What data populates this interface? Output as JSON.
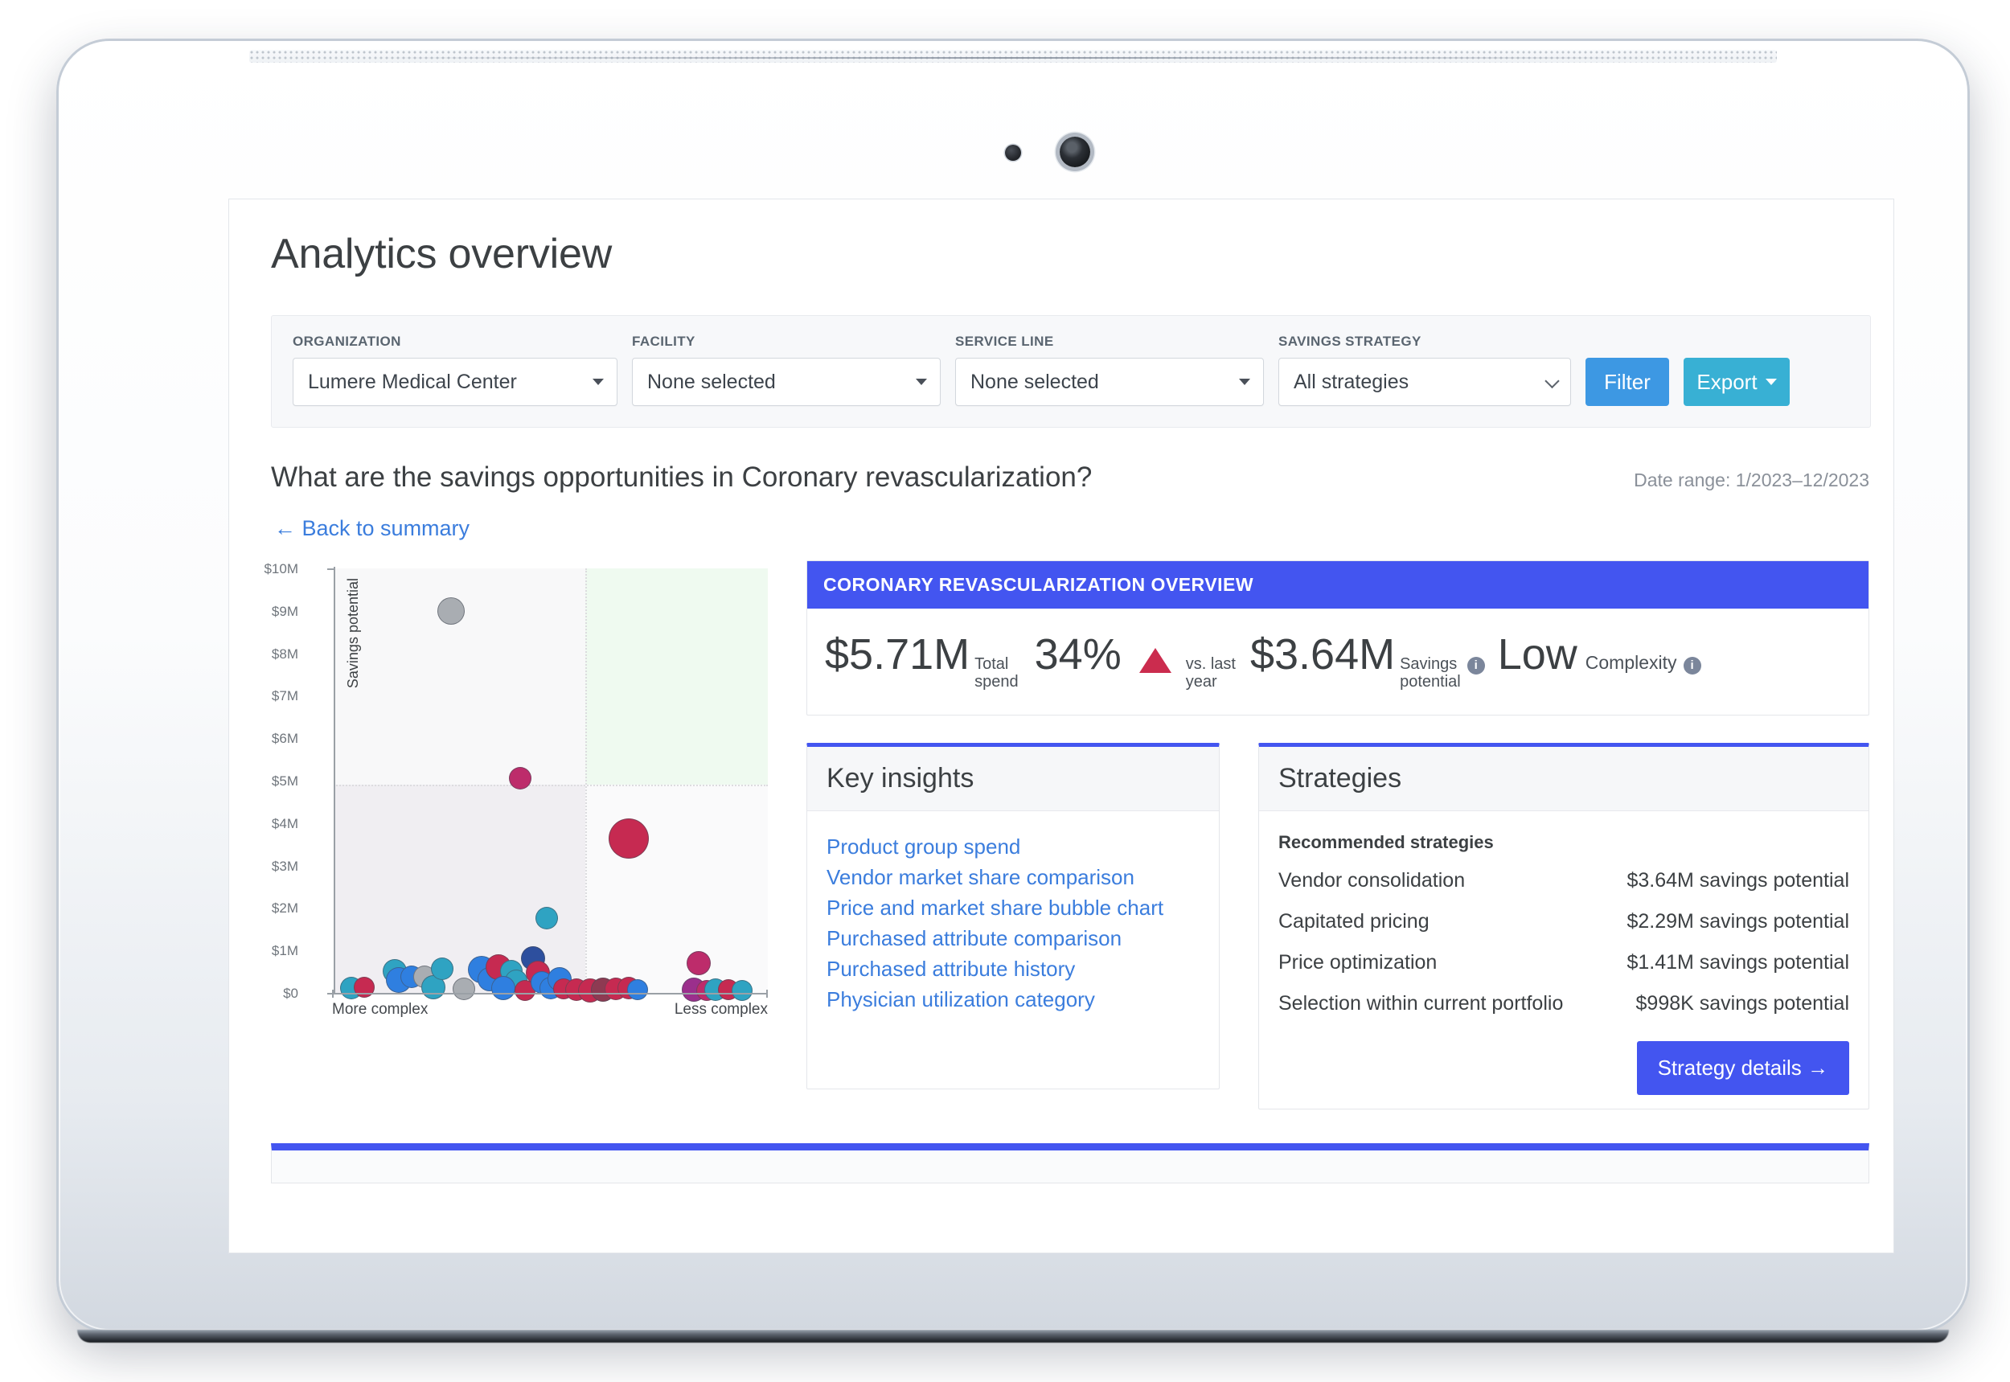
{
  "app": {
    "page_title": "Analytics overview"
  },
  "filters": {
    "organization": {
      "label": "ORGANIZATION",
      "value": "Lumere Medical Center"
    },
    "facility": {
      "label": "FACILITY",
      "value": "None selected"
    },
    "service_line": {
      "label": "SERVICE LINE",
      "value": "None selected"
    },
    "savings_strategy": {
      "label": "SAVINGS STRATEGY",
      "value": "All strategies"
    },
    "filter_button": "Filter",
    "export_button": "Export"
  },
  "question": {
    "text": "What are the savings opportunities in Coronary revascularization?",
    "date_range": "Date range: 1/2023–12/2023",
    "back_link": "← Back to summary"
  },
  "overview": {
    "header": "CORONARY REVASCULARIZATION OVERVIEW",
    "total_spend_value": "$5.71M",
    "total_spend_label_1": "Total",
    "total_spend_label_2": "spend",
    "delta_value": "34%",
    "delta_direction": "up-triangle-icon",
    "delta_label_1": "vs. last",
    "delta_label_2": "year",
    "savings_value": "$3.64M",
    "savings_label_1": "Savings",
    "savings_label_2": "potential",
    "complexity_value": "Low",
    "complexity_label": "Complexity",
    "info_icon": "info-icon",
    "accent_color": "#4355f0"
  },
  "key_insights": {
    "title": "Key insights",
    "links": [
      "Product group spend",
      "Vendor market share comparison",
      "Price and market share bubble chart",
      "Purchased attribute comparison",
      "Purchased attribute history",
      "Physician utilization category"
    ]
  },
  "strategies": {
    "title": "Strategies",
    "subtitle": "Recommended strategies",
    "rows": [
      {
        "name": "Vendor consolidation",
        "value": "$3.64M savings potential"
      },
      {
        "name": "Capitated pricing",
        "value": "$2.29M savings potential"
      },
      {
        "name": "Price optimization",
        "value": "$1.41M savings potential"
      },
      {
        "name": "Selection within current portfolio",
        "value": "$998K savings potential"
      }
    ],
    "details_button": "Strategy details →"
  },
  "chart_data": {
    "type": "scatter",
    "title": "",
    "xlabel": "",
    "ylabel": "Savings potential",
    "x_axis_left_label": "More complex",
    "x_axis_right_label": "Less complex",
    "ylim": [
      0,
      10000000
    ],
    "ytick_labels": [
      "$10M",
      "$9M",
      "$8M",
      "$7M",
      "$6M",
      "$5M",
      "$4M",
      "$3M",
      "$2M",
      "$1M",
      "$0"
    ],
    "ytick_values": [
      10000000,
      9000000,
      8000000,
      7000000,
      6000000,
      5000000,
      4000000,
      3000000,
      2000000,
      1000000,
      0
    ],
    "grid": false,
    "legend": "none",
    "quadrants": {
      "split_x_pct": 58,
      "split_y_value": 5000000,
      "top_left_color": "#f8f8f9",
      "top_right_color": "#effaf0",
      "bottom_left_color": "#f0eef2",
      "bottom_right_color": "#fafafb"
    },
    "series_colors": {
      "teal": "#3aa6bd",
      "blue": "#2f7fe0",
      "crimson": "#c62a51",
      "gray": "#a9adb2",
      "navy": "#2d4f9e"
    },
    "points": [
      {
        "x": 27,
        "y": 9000000,
        "r": 17,
        "color": "#a9adb2"
      },
      {
        "x": 43,
        "y": 5050000,
        "r": 14,
        "color": "#bd2c6b"
      },
      {
        "x": 68,
        "y": 3630000,
        "r": 25,
        "color": "#c62a51"
      },
      {
        "x": 49,
        "y": 1760000,
        "r": 14,
        "color": "#2fa3c2"
      },
      {
        "x": 4,
        "y": 120000,
        "r": 14,
        "color": "#2fa3c2"
      },
      {
        "x": 7,
        "y": 130000,
        "r": 13,
        "color": "#c62a51"
      },
      {
        "x": 14,
        "y": 520000,
        "r": 15,
        "color": "#2fa3c2"
      },
      {
        "x": 15,
        "y": 300000,
        "r": 16,
        "color": "#2f7fe0"
      },
      {
        "x": 18,
        "y": 370000,
        "r": 14,
        "color": "#2f7fe0"
      },
      {
        "x": 21,
        "y": 380000,
        "r": 14,
        "color": "#a9adb2"
      },
      {
        "x": 23,
        "y": 140000,
        "r": 15,
        "color": "#2fa3c2"
      },
      {
        "x": 25,
        "y": 560000,
        "r": 14,
        "color": "#2fa3c2"
      },
      {
        "x": 30,
        "y": 90000,
        "r": 14,
        "color": "#a9adb2"
      },
      {
        "x": 34,
        "y": 540000,
        "r": 17,
        "color": "#2f7fe0"
      },
      {
        "x": 36,
        "y": 330000,
        "r": 15,
        "color": "#2f7fe0"
      },
      {
        "x": 38,
        "y": 600000,
        "r": 16,
        "color": "#c62a51"
      },
      {
        "x": 41,
        "y": 520000,
        "r": 14,
        "color": "#2fa3c2"
      },
      {
        "x": 42,
        "y": 290000,
        "r": 14,
        "color": "#2fa3c2"
      },
      {
        "x": 39,
        "y": 110000,
        "r": 15,
        "color": "#2f7fe0"
      },
      {
        "x": 44,
        "y": 60000,
        "r": 13,
        "color": "#c62a51"
      },
      {
        "x": 46,
        "y": 820000,
        "r": 15,
        "color": "#2d4f9e"
      },
      {
        "x": 47,
        "y": 470000,
        "r": 15,
        "color": "#c62a51"
      },
      {
        "x": 48,
        "y": 250000,
        "r": 14,
        "color": "#2f7fe0"
      },
      {
        "x": 50,
        "y": 120000,
        "r": 14,
        "color": "#2f7fe0"
      },
      {
        "x": 52,
        "y": 330000,
        "r": 15,
        "color": "#2f7fe0"
      },
      {
        "x": 53,
        "y": 90000,
        "r": 13,
        "color": "#c62a51"
      },
      {
        "x": 56,
        "y": 70000,
        "r": 14,
        "color": "#c62a51"
      },
      {
        "x": 59,
        "y": 60000,
        "r": 15,
        "color": "#c62a51"
      },
      {
        "x": 62,
        "y": 80000,
        "r": 15,
        "color": "#8e3a52"
      },
      {
        "x": 65,
        "y": 90000,
        "r": 14,
        "color": "#c62a51"
      },
      {
        "x": 68,
        "y": 110000,
        "r": 14,
        "color": "#c62a51"
      },
      {
        "x": 70,
        "y": 70000,
        "r": 13,
        "color": "#2f7fe0"
      },
      {
        "x": 84,
        "y": 700000,
        "r": 15,
        "color": "#bd2c6b"
      },
      {
        "x": 83,
        "y": 80000,
        "r": 15,
        "color": "#9b2f8c"
      },
      {
        "x": 86,
        "y": 60000,
        "r": 13,
        "color": "#bd2c6b"
      },
      {
        "x": 88,
        "y": 70000,
        "r": 14,
        "color": "#2fa3c2"
      },
      {
        "x": 91,
        "y": 70000,
        "r": 13,
        "color": "#c62a51"
      },
      {
        "x": 94,
        "y": 50000,
        "r": 13,
        "color": "#2fa3c2"
      }
    ]
  }
}
